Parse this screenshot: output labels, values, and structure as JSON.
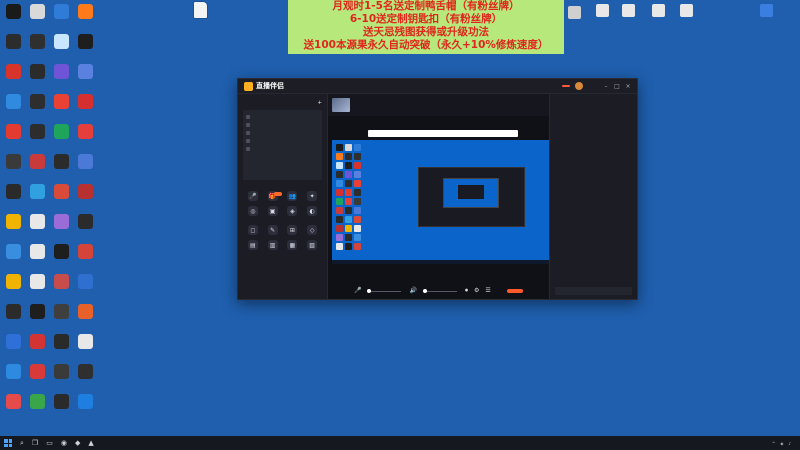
{
  "promo": {
    "line1": "月观时1-5名送定制鸭舌帽（有粉丝牌）",
    "line2": "6-10送定制钥匙扣（有粉丝牌）",
    "line3": "送天忌残图获得或升级功法",
    "line4": "送100本源果永久自动突破（永久+10%修炼速度）"
  },
  "desktop_icons": [
    {
      "label": "",
      "color": "#1a1a1a"
    },
    {
      "label": "",
      "color": "#d9d9d9"
    },
    {
      "label": "",
      "color": "#2f7bd8"
    },
    {
      "label": "",
      "color": "#ff7a1a"
    },
    {
      "label": "",
      "color": "#2c2c2c"
    },
    {
      "label": "",
      "color": "#2f2f2f"
    },
    {
      "label": "",
      "color": "#c9e6ff"
    },
    {
      "label": "",
      "color": "#1e1e1e"
    },
    {
      "label": "",
      "color": "#d9342b"
    },
    {
      "label": "",
      "color": "#2b2b2b"
    },
    {
      "label": "",
      "color": "#6f54d8"
    },
    {
      "label": "",
      "color": "#5a80e0"
    },
    {
      "label": "",
      "color": "#2f8ae0"
    },
    {
      "label": "",
      "color": "#2e2e2e"
    },
    {
      "label": "",
      "color": "#e94235"
    },
    {
      "label": "",
      "color": "#d52f2f"
    },
    {
      "label": "",
      "color": "#e33b2f"
    },
    {
      "label": "",
      "color": "#2d2d2d"
    },
    {
      "label": "",
      "color": "#1fa45b"
    },
    {
      "label": "",
      "color": "#e63d3d"
    },
    {
      "label": "",
      "color": "#3a3a3a"
    },
    {
      "label": "",
      "color": "#c93a3a"
    },
    {
      "label": "",
      "color": "#2b2b2b"
    },
    {
      "label": "",
      "color": "#4a79d8"
    },
    {
      "label": "",
      "color": "#2a2a2a"
    },
    {
      "label": "",
      "color": "#30a0e0"
    },
    {
      "label": "",
      "color": "#d84a3a"
    },
    {
      "label": "",
      "color": "#b83030"
    },
    {
      "label": "",
      "color": "#f0b400"
    },
    {
      "label": "",
      "color": "#e8e8e8"
    },
    {
      "label": "",
      "color": "#9a6cd8"
    },
    {
      "label": "",
      "color": "#2b2b2b"
    },
    {
      "label": "",
      "color": "#3a8ee0"
    },
    {
      "label": "",
      "color": "#e8e8e8"
    },
    {
      "label": "",
      "color": "#1e1e1e"
    },
    {
      "label": "",
      "color": "#d4443a"
    },
    {
      "label": "",
      "color": "#f0b400"
    },
    {
      "label": "",
      "color": "#e8e8e8"
    },
    {
      "label": "",
      "color": "#c94c4c"
    },
    {
      "label": "",
      "color": "#2e6fd0"
    },
    {
      "label": "",
      "color": "#2b2b2b"
    },
    {
      "label": "",
      "color": "#1e1e1e"
    },
    {
      "label": "",
      "color": "#3f3f3f"
    },
    {
      "label": "",
      "color": "#e8602a"
    },
    {
      "label": "",
      "color": "#2f6fd8"
    },
    {
      "label": "",
      "color": "#d23434"
    },
    {
      "label": "",
      "color": "#2a2a2a"
    },
    {
      "label": "",
      "color": "#e8e8e8"
    },
    {
      "label": "",
      "color": "#2e8ae0"
    },
    {
      "label": "",
      "color": "#d83a3a"
    },
    {
      "label": "",
      "color": "#3a3a3a"
    },
    {
      "label": "",
      "color": "#2f2f2f"
    },
    {
      "label": "",
      "color": "#e64b4b"
    },
    {
      "label": "",
      "color": "#3aa64a"
    },
    {
      "label": "",
      "color": "#2a2a2a"
    },
    {
      "label": "",
      "color": "#1e7fe0"
    }
  ],
  "top_file_icons": [
    {
      "label": ""
    }
  ],
  "top_right_icons": [
    {
      "label": "",
      "color": "#d0d0d0"
    },
    {
      "label": "",
      "color": "#e8e8e8"
    },
    {
      "label": "",
      "color": "#e8e8e8"
    },
    {
      "label": "",
      "color": "#e8e8e8"
    },
    {
      "label": "",
      "color": "#e8e8e8"
    },
    {
      "label": "",
      "color": "#3a7fe0"
    }
  ],
  "app": {
    "brand": "直播伴侣",
    "version": "",
    "live_button": "",
    "title_links": [
      "",
      "",
      ""
    ],
    "left": {
      "scene_title": "",
      "scene_rows": [
        "",
        "",
        "",
        "",
        ""
      ],
      "add_source": "",
      "tools_title": "",
      "tools": [
        {
          "icon": "🎤",
          "label": ""
        },
        {
          "icon": "🎁",
          "label": ""
        },
        {
          "icon": "👥",
          "label": ""
        },
        {
          "icon": "✦",
          "label": ""
        },
        {
          "icon": "◎",
          "label": ""
        },
        {
          "icon": "▣",
          "label": ""
        },
        {
          "icon": "◈",
          "label": ""
        },
        {
          "icon": "◐",
          "label": ""
        }
      ],
      "basic_title": "",
      "basic_tools": [
        {
          "icon": "◻",
          "label": ""
        },
        {
          "icon": "✎",
          "label": ""
        },
        {
          "icon": "⊞",
          "label": ""
        },
        {
          "icon": "◇",
          "label": ""
        },
        {
          "icon": "▤",
          "label": ""
        },
        {
          "icon": "▥",
          "label": ""
        },
        {
          "icon": "▦",
          "label": ""
        },
        {
          "icon": "▧",
          "label": ""
        }
      ],
      "more_tools": "",
      "tip": ""
    },
    "center": {
      "stream_title": "",
      "stars": "",
      "notice": "",
      "controls": [
        {
          "icon": "🎤",
          "label": ""
        },
        {
          "icon": "🔊",
          "label": ""
        },
        {
          "icon": "⏺",
          "label": ""
        },
        {
          "icon": "⚙",
          "label": ""
        },
        {
          "icon": "☰",
          "label": ""
        }
      ],
      "mic_pct": "",
      "spk_pct": "",
      "start_live": "",
      "status": ""
    },
    "right": {
      "title": "",
      "tabs": [
        "",
        "",
        ""
      ],
      "chat": [
        {
          "text": "",
          "style": ""
        },
        {
          "text": "",
          "style": ""
        },
        {
          "text": "",
          "style": ""
        },
        {
          "text": "",
          "style": ""
        },
        {
          "text": "",
          "style": "hl"
        },
        {
          "text": "",
          "style": "pk"
        },
        {
          "text": "",
          "style": ""
        }
      ],
      "input_placeholder": ""
    }
  },
  "taskbar": {
    "time": "",
    "date": ""
  }
}
